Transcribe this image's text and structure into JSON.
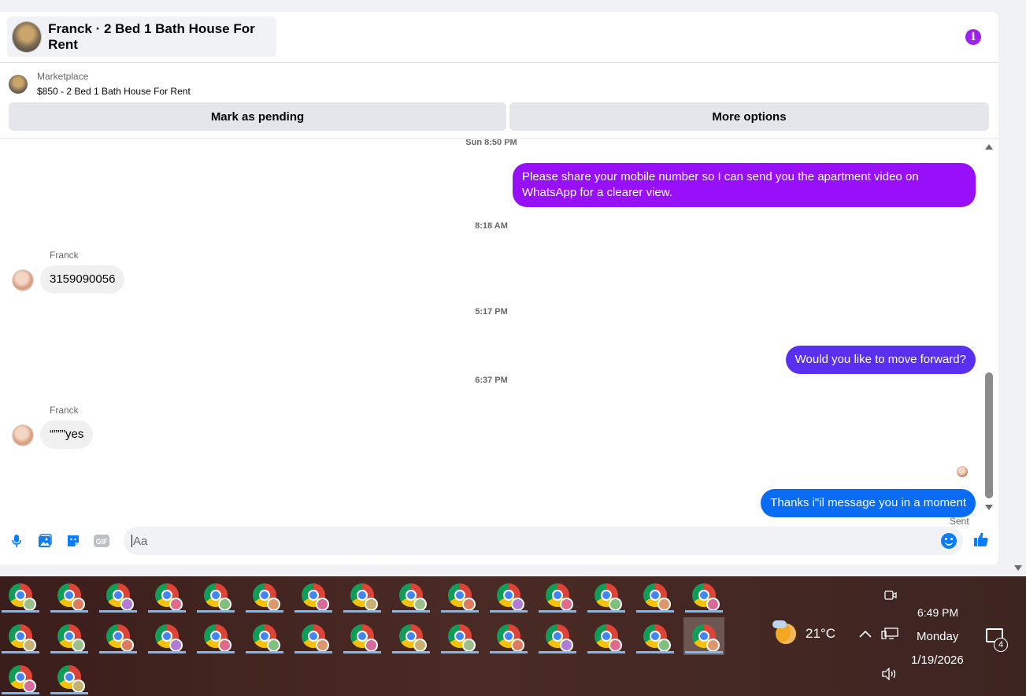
{
  "header": {
    "title": "Franck · 2 Bed 1 Bath House For Rent",
    "info_icon": "info-icon"
  },
  "listing": {
    "source": "Marketplace",
    "name": "$850 - 2 Bed 1 Bath House For Rent"
  },
  "actions": {
    "mark_pending": "Mark as pending",
    "more_options": "More options"
  },
  "messages": {
    "ts1": "Sun 8:50 PM",
    "out1": "Please share your mobile number so I can send you the apartment video on WhatsApp for a clearer view.",
    "ts2": "8:18 AM",
    "sender1": "Franck",
    "in1": "3159090056",
    "ts3": "5:17 PM",
    "out2": "Would you like to move forward?",
    "ts4": "6:37 PM",
    "sender2": "Franck",
    "in2": "“”””yes",
    "out3": "Thanks i\"il message you in a moment",
    "status": "Sent"
  },
  "colors": {
    "out1": "#9810fa",
    "out2": "#5a30f0",
    "out3": "#0a6cf5"
  },
  "composer": {
    "placeholder": "Aa",
    "icons": [
      "mic-icon",
      "photo-icon",
      "sticker-icon",
      "gif-icon",
      "emoji-icon",
      "like-icon"
    ],
    "gif_label": "GIF"
  },
  "taskbar": {
    "weather_temp": "21°C",
    "time": "6:49 PM",
    "day": "Monday",
    "date": "1/19/2026",
    "notification_count": "4"
  }
}
